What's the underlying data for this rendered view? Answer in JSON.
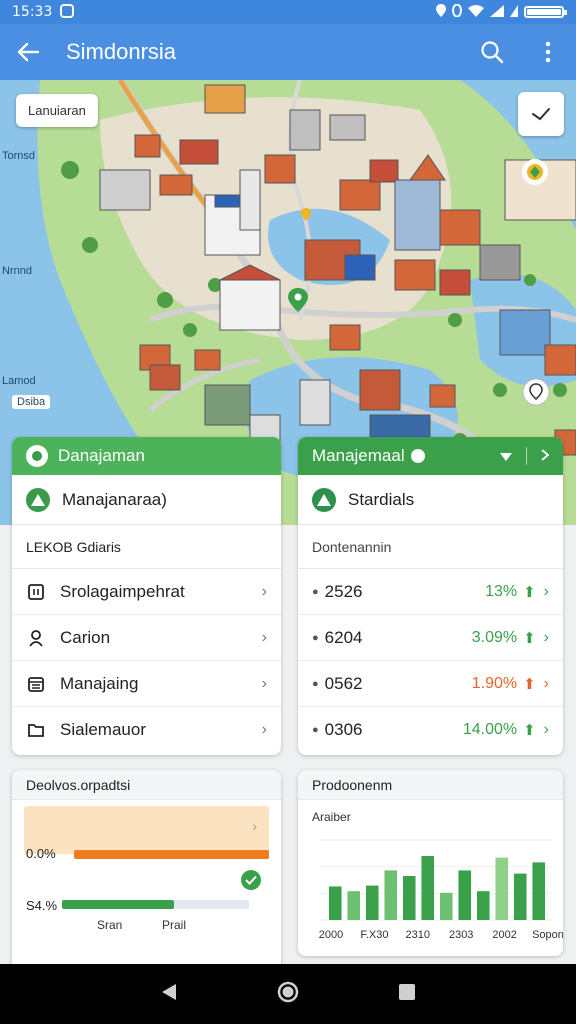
{
  "status_bar": {
    "time": "15:33"
  },
  "app_bar": {
    "title": "Simdonrsia"
  },
  "map": {
    "chip_label": "Lanuiaran",
    "side_labels": [
      "Tornsd",
      "Nrnnd",
      "Lamod"
    ],
    "bottom_label": "Dsiba"
  },
  "card_left": {
    "header": "Danajaman",
    "subtitle": "Manajanaraa)",
    "section_label": "LEKOB Gdiaris",
    "items": [
      {
        "label": "Srolagaimpehrat",
        "icon": "building-icon"
      },
      {
        "label": "Carion",
        "icon": "person-icon"
      },
      {
        "label": "Manajaing",
        "icon": "calendar-icon"
      },
      {
        "label": "Sialemauor",
        "icon": "folder-icon"
      }
    ]
  },
  "card_right": {
    "header": "Manajemaal",
    "subtitle": "Stardials",
    "section_label": "Dontenannin",
    "rows": [
      {
        "value": "2526",
        "pct": "13%",
        "color": "#3aa14a"
      },
      {
        "value": "6204",
        "pct": "3.09%",
        "color": "#3aa14a"
      },
      {
        "value": "0562",
        "pct": "1.90%",
        "color": "#e2662a"
      },
      {
        "value": "0306",
        "pct": "14.00%",
        "color": "#3aa14a"
      }
    ]
  },
  "progress_card": {
    "header": "Deolvos.orpadtsi",
    "bars": [
      {
        "label": "0.0%",
        "fraction": 1.0,
        "color": "#ef7d1f"
      },
      {
        "label": "S4.%",
        "fraction": 0.6,
        "color": "#3aa14a"
      }
    ],
    "axis_labels": [
      "Sran",
      "Prail"
    ]
  },
  "chart_card": {
    "header": "Prodoonenm",
    "subtitle": "Araiber"
  },
  "chart_data": {
    "type": "bar",
    "title": "Prodoonenm",
    "x_tick_labels": [
      "2000",
      "F.X30",
      "2310",
      "2303",
      "2002",
      "Sopon"
    ],
    "values": [
      42,
      36,
      43,
      62,
      55,
      80,
      34,
      62,
      36,
      78,
      58,
      72
    ],
    "colors": [
      "#3aa14a",
      "#6cc070",
      "#3aa14a",
      "#6cc070",
      "#3aa14a",
      "#3aa14a",
      "#6cc070",
      "#3aa14a",
      "#3aa14a",
      "#8fd18a",
      "#3aa14a",
      "#3aa14a"
    ],
    "ylim": [
      0,
      100
    ],
    "grid": true
  }
}
